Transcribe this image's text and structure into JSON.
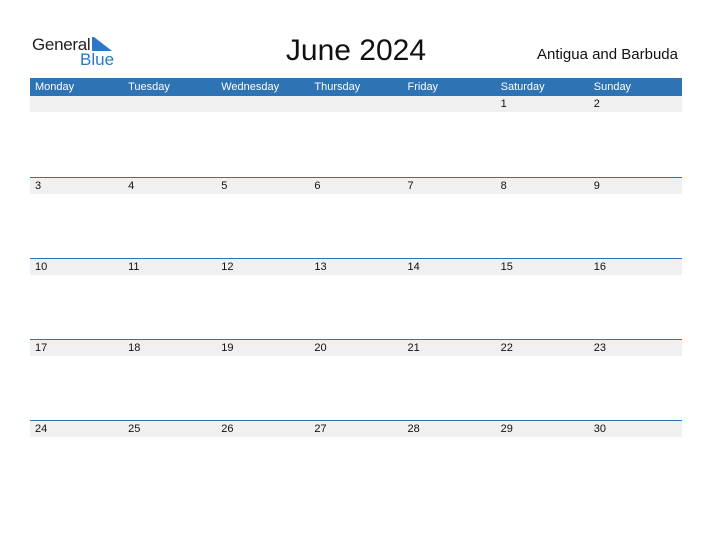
{
  "logo": {
    "general": "General",
    "blue": "Blue"
  },
  "title": "June 2024",
  "country": "Antigua and Barbuda",
  "colors": {
    "accent": "#2e73b4",
    "date_strip": "#f0f0f0"
  },
  "weekdays": [
    "Monday",
    "Tuesday",
    "Wednesday",
    "Thursday",
    "Friday",
    "Saturday",
    "Sunday"
  ],
  "weeks": [
    [
      "",
      "",
      "",
      "",
      "",
      "1",
      "2"
    ],
    [
      "3",
      "4",
      "5",
      "6",
      "7",
      "8",
      "9"
    ],
    [
      "10",
      "11",
      "12",
      "13",
      "14",
      "15",
      "16"
    ],
    [
      "17",
      "18",
      "19",
      "20",
      "21",
      "22",
      "23"
    ],
    [
      "24",
      "25",
      "26",
      "27",
      "28",
      "29",
      "30"
    ]
  ]
}
